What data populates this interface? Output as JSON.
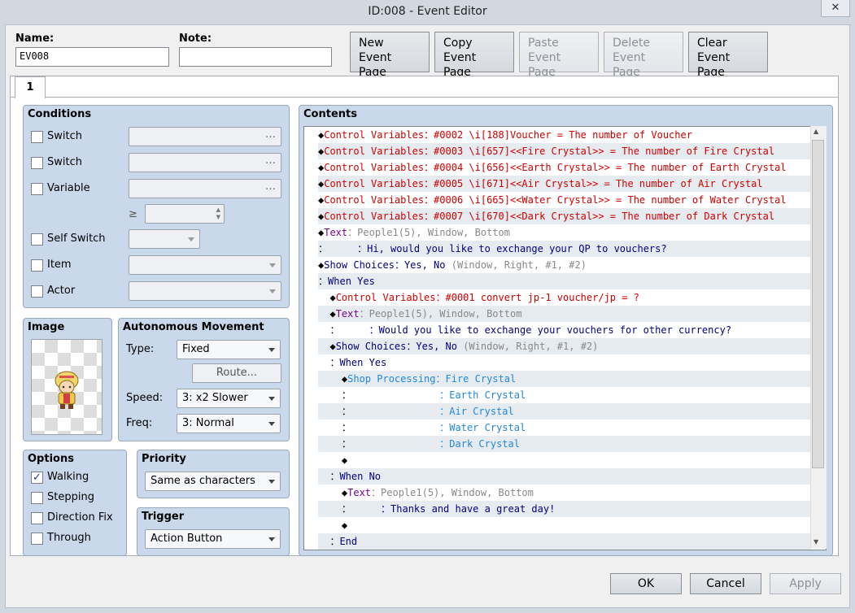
{
  "window": {
    "title": "ID:008 - Event Editor",
    "close_glyph": "✕"
  },
  "header": {
    "name_label": "Name:",
    "name_value": "EV008",
    "note_label": "Note:",
    "note_value": "",
    "buttons": [
      {
        "line1": "New",
        "line2": "Event Page",
        "enabled": true
      },
      {
        "line1": "Copy",
        "line2": "Event Page",
        "enabled": true
      },
      {
        "line1": "Paste",
        "line2": "Event Page",
        "enabled": false
      },
      {
        "line1": "Delete",
        "line2": "Event Page",
        "enabled": false
      },
      {
        "line1": "Clear",
        "line2": "Event Page",
        "enabled": true
      }
    ]
  },
  "tabs": [
    {
      "label": "1"
    }
  ],
  "conditions": {
    "title": "Conditions",
    "switch1": "Switch",
    "switch2": "Switch",
    "variable": "Variable",
    "ge": "≥",
    "self_switch": "Self Switch",
    "item": "Item",
    "actor": "Actor",
    "dots": "…"
  },
  "image": {
    "title": "Image",
    "sprite": "character-sprite"
  },
  "autonomous": {
    "title": "Autonomous Movement",
    "type_label": "Type:",
    "type_value": "Fixed",
    "route": "Route...",
    "speed_label": "Speed:",
    "speed_value": "3: x2 Slower",
    "freq_label": "Freq:",
    "freq_value": "3: Normal"
  },
  "options": {
    "title": "Options",
    "items": [
      {
        "label": "Walking",
        "checked": true
      },
      {
        "label": "Stepping",
        "checked": false
      },
      {
        "label": "Direction Fix",
        "checked": false
      },
      {
        "label": "Through",
        "checked": false
      }
    ]
  },
  "priority": {
    "title": "Priority",
    "value": "Same as characters"
  },
  "trigger": {
    "title": "Trigger",
    "value": "Action Button"
  },
  "contents": {
    "title": "Contents",
    "lines": [
      [
        {
          "t": "◆",
          "c": "#000"
        },
        {
          "t": "Control Variables：#0002 \\i[188]Voucher = The number of Voucher",
          "c": "#d00000"
        }
      ],
      [
        {
          "t": "◆",
          "c": "#000"
        },
        {
          "t": "Control Variables：#0003 \\i[657]<<Fire Crystal>> = The number of Fire Crystal",
          "c": "#d00000"
        }
      ],
      [
        {
          "t": "◆",
          "c": "#000"
        },
        {
          "t": "Control Variables：#0004 \\i[656]<<Earth Crystal>> = The number of Earth Crystal",
          "c": "#d00000"
        }
      ],
      [
        {
          "t": "◆",
          "c": "#000"
        },
        {
          "t": "Control Variables：#0005 \\i[671]<<Air Crystal>> = The number of Air Crystal",
          "c": "#d00000"
        }
      ],
      [
        {
          "t": "◆",
          "c": "#000"
        },
        {
          "t": "Control Variables：#0006 \\i[665]<<Water Crystal>> = The number of Water Crystal",
          "c": "#d00000"
        }
      ],
      [
        {
          "t": "◆",
          "c": "#000"
        },
        {
          "t": "Control Variables：#0007 \\i[670]<<Dark Crystal>> = The number of Dark Crystal",
          "c": "#d00000"
        }
      ],
      [
        {
          "t": "◆",
          "c": "#000"
        },
        {
          "t": "Text",
          "c": "#7a0096"
        },
        {
          "t": "：People1(5), Window, Bottom",
          "c": "#888"
        }
      ],
      [
        {
          "t": "：",
          "c": "#000"
        },
        {
          "t": "     ：Hi, would you like to exchange your QP to vouchers?",
          "c": "#000080"
        }
      ],
      [
        {
          "t": "◆",
          "c": "#000"
        },
        {
          "t": "Show Choices",
          "c": "#000080"
        },
        {
          "t": "：Yes, No ",
          "c": "#000080"
        },
        {
          "t": "(Window, Right, #1, #2)",
          "c": "#888"
        }
      ],
      [
        {
          "t": "：",
          "c": "#000"
        },
        {
          "t": "When Yes",
          "c": "#000080"
        }
      ],
      [
        {
          "t": "  ◆",
          "c": "#000"
        },
        {
          "t": "Control Variables：#0001 convert jp-1 voucher/jp = ?",
          "c": "#d00000"
        }
      ],
      [
        {
          "t": "  ◆",
          "c": "#000"
        },
        {
          "t": "Text",
          "c": "#7a0096"
        },
        {
          "t": "：People1(5), Window, Bottom",
          "c": "#888"
        }
      ],
      [
        {
          "t": "  ：",
          "c": "#000"
        },
        {
          "t": "     ：Would you like to exchange your vouchers for other currency?",
          "c": "#000080"
        }
      ],
      [
        {
          "t": "  ◆",
          "c": "#000"
        },
        {
          "t": "Show Choices",
          "c": "#000080"
        },
        {
          "t": "：Yes, No ",
          "c": "#000080"
        },
        {
          "t": "(Window, Right, #1, #2)",
          "c": "#888"
        }
      ],
      [
        {
          "t": "  ：",
          "c": "#000"
        },
        {
          "t": "When Yes",
          "c": "#000080"
        }
      ],
      [
        {
          "t": "    ◆",
          "c": "#000"
        },
        {
          "t": "Shop Processing：Fire Crystal",
          "c": "#2288dd"
        }
      ],
      [
        {
          "t": "    ：",
          "c": "#000"
        },
        {
          "t": "               ：Earth Crystal",
          "c": "#2288dd"
        }
      ],
      [
        {
          "t": "    ：",
          "c": "#000"
        },
        {
          "t": "               ：Air Crystal",
          "c": "#2288dd"
        }
      ],
      [
        {
          "t": "    ：",
          "c": "#000"
        },
        {
          "t": "               ：Water Crystal",
          "c": "#2288dd"
        }
      ],
      [
        {
          "t": "    ：",
          "c": "#000"
        },
        {
          "t": "               ：Dark Crystal",
          "c": "#2288dd"
        }
      ],
      [
        {
          "t": "    ◆",
          "c": "#000"
        }
      ],
      [
        {
          "t": "  ：",
          "c": "#000"
        },
        {
          "t": "When No",
          "c": "#000080"
        }
      ],
      [
        {
          "t": "    ◆",
          "c": "#000"
        },
        {
          "t": "Text",
          "c": "#7a0096"
        },
        {
          "t": "：People1(5), Window, Bottom",
          "c": "#888"
        }
      ],
      [
        {
          "t": "    ：",
          "c": "#000"
        },
        {
          "t": "     ：Thanks and have a great day!",
          "c": "#000080"
        }
      ],
      [
        {
          "t": "    ◆",
          "c": "#000"
        }
      ],
      [
        {
          "t": "  ：",
          "c": "#000"
        },
        {
          "t": "End",
          "c": "#000080"
        }
      ]
    ]
  },
  "footer": {
    "ok": "OK",
    "cancel": "Cancel",
    "apply": "Apply"
  }
}
